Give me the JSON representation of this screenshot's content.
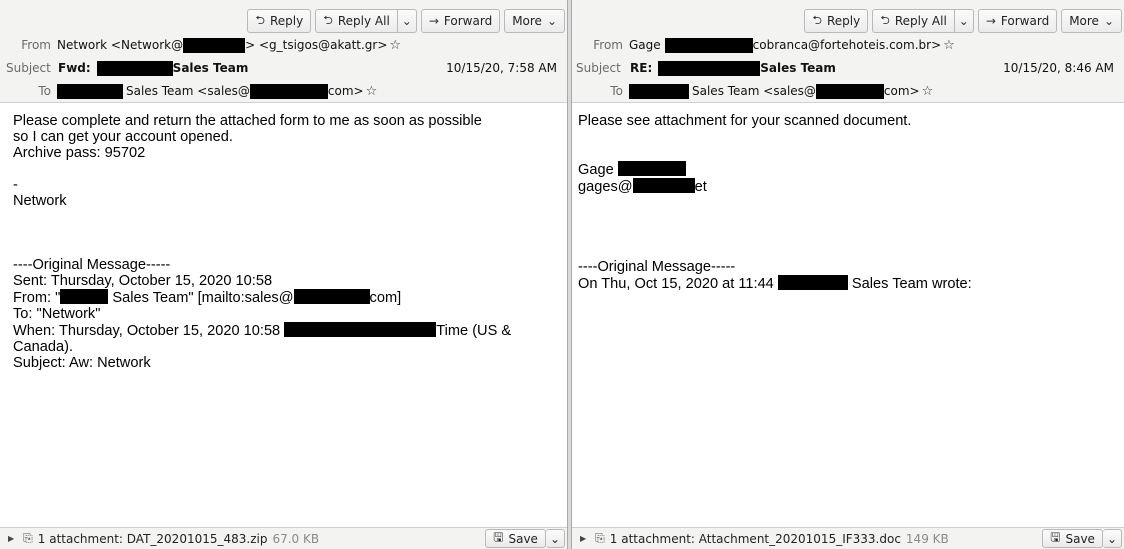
{
  "left": {
    "toolbar": {
      "reply": "Reply",
      "reply_all": "Reply All",
      "forward": "Forward",
      "more": "More"
    },
    "header": {
      "from_label": "From",
      "from_prefix": "Network <Network@",
      "from_suffix": "> <g_tsigos@akatt.gr>",
      "subject_label": "Subject",
      "subject_prefix": "Fwd:",
      "subject_suffix": "Sales Team",
      "date": "10/15/20, 7:58 AM",
      "to_label": "To",
      "to_mid": "Sales Team <sales@",
      "to_suffix": "com>"
    },
    "body": {
      "line1": "Please complete and return the attached form to me as soon as possible",
      "line2": "so I can get your account opened.",
      "line3": "Archive pass: 95702",
      "line4": "-",
      "line5": "Network",
      "line6": "----Original Message-----",
      "line7": "Sent: Thursday, October 15, 2020 10:58",
      "line8a": "From: \"",
      "line8b": "Sales Team\" [mailto:sales@",
      "line8c": "com]",
      "line9": "To: \"Network\"",
      "line10a": "When: Thursday, October 15, 2020 10:58",
      "line10b": "Time (US &",
      "line11": "Canada).",
      "line12": "Subject: Aw: Network"
    },
    "footer": {
      "attachment": "1 attachment: DAT_20201015_483.zip",
      "size": "67.0 KB",
      "save": "Save"
    }
  },
  "right": {
    "toolbar": {
      "reply": "Reply",
      "reply_all": "Reply All",
      "forward": "Forward",
      "more": "More"
    },
    "header": {
      "from_label": "From",
      "from_prefix": "Gage",
      "from_suffix": "cobranca@fortehoteis.com.br>",
      "subject_label": "Subject",
      "subject_prefix": "RE:",
      "subject_suffix": "Sales Team",
      "date": "10/15/20, 8:46 AM",
      "to_label": "To",
      "to_mid": "Sales Team <sales@",
      "to_suffix": "com>"
    },
    "body": {
      "line1": "Please see attachment for your scanned document.",
      "line2": "Gage",
      "line3a": "gages@",
      "line3b": "et",
      "line4": "----Original Message-----",
      "line5a": "On Thu, Oct 15, 2020 at 11:44",
      "line5b": "Sales Team wrote:"
    },
    "footer": {
      "attachment": "1 attachment: Attachment_20201015_IF333.doc",
      "size": "149 KB",
      "save": "Save"
    }
  }
}
